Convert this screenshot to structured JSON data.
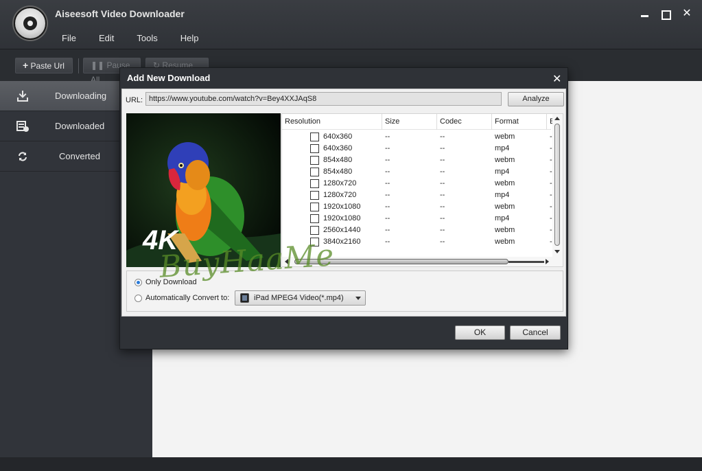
{
  "app": {
    "title": "Aiseesoft Video Downloader",
    "menu": [
      "File",
      "Edit",
      "Tools",
      "Help"
    ]
  },
  "toolbar": {
    "paste_url": "Paste Url",
    "pause_all": "Pause All",
    "resume_all": "Resume All"
  },
  "sidebar": {
    "items": [
      {
        "label": "Downloading",
        "icon": "download-icon",
        "active": true
      },
      {
        "label": "Downloaded",
        "icon": "film-check-icon",
        "active": false
      },
      {
        "label": "Converted",
        "icon": "convert-icon",
        "active": false
      }
    ]
  },
  "dialog": {
    "title": "Add New Download",
    "url_label": "URL:",
    "url_value": "https://www.youtube.com/watch?v=Bey4XXJAqS8",
    "analyze_label": "Analyze",
    "preview_badge": "4K",
    "columns": [
      "Resolution",
      "Size",
      "Codec",
      "Format",
      "E"
    ],
    "rows": [
      {
        "resolution": "640x360",
        "size": "--",
        "codec": "--",
        "format": "webm",
        "ext": "-"
      },
      {
        "resolution": "640x360",
        "size": "--",
        "codec": "--",
        "format": "mp4",
        "ext": "-"
      },
      {
        "resolution": "854x480",
        "size": "--",
        "codec": "--",
        "format": "webm",
        "ext": "-"
      },
      {
        "resolution": "854x480",
        "size": "--",
        "codec": "--",
        "format": "mp4",
        "ext": "-"
      },
      {
        "resolution": "1280x720",
        "size": "--",
        "codec": "--",
        "format": "webm",
        "ext": "-"
      },
      {
        "resolution": "1280x720",
        "size": "--",
        "codec": "--",
        "format": "mp4",
        "ext": "-"
      },
      {
        "resolution": "1920x1080",
        "size": "--",
        "codec": "--",
        "format": "webm",
        "ext": "-"
      },
      {
        "resolution": "1920x1080",
        "size": "--",
        "codec": "--",
        "format": "mp4",
        "ext": "-"
      },
      {
        "resolution": "2560x1440",
        "size": "--",
        "codec": "--",
        "format": "webm",
        "ext": "-"
      },
      {
        "resolution": "3840x2160",
        "size": "--",
        "codec": "--",
        "format": "webm",
        "ext": "-"
      }
    ],
    "only_download_label": "Only Download",
    "auto_convert_label": "Automatically Convert to:",
    "convert_format": "iPad MPEG4 Video(*.mp4)",
    "ok_label": "OK",
    "cancel_label": "Cancel"
  },
  "watermark": "BuyHaaMe",
  "colors": {
    "radio_accent": "#2a7ad8",
    "dark_chrome": "#2f3237"
  }
}
